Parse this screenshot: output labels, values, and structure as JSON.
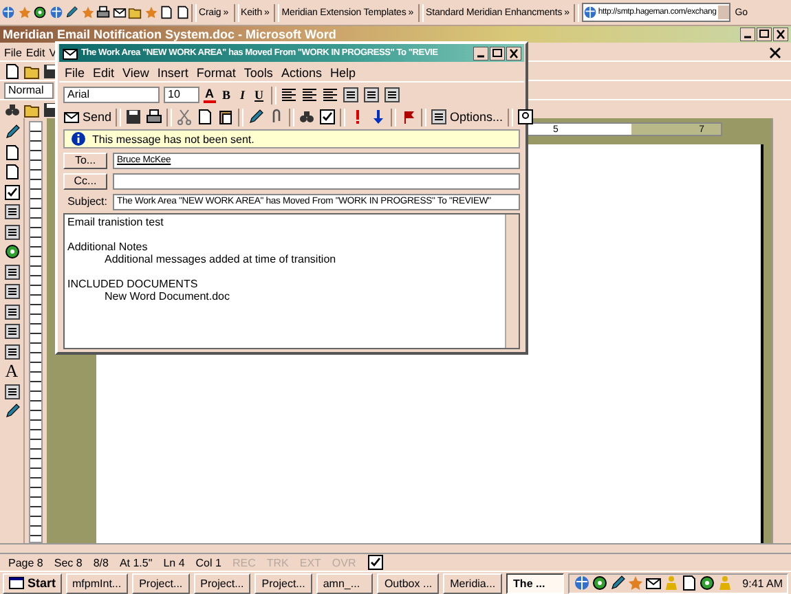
{
  "links_bar": {
    "links": [
      {
        "label": "Craig",
        "chevron": "»"
      },
      {
        "label": "Keith",
        "chevron": "»"
      },
      {
        "label": "Meridian Extension Templates",
        "chevron": "»"
      },
      {
        "label": "Standard Meridian Enhancments",
        "chevron": "»"
      }
    ],
    "address": "http://smtp.hageman.com/exchang",
    "go": "Go"
  },
  "word": {
    "title": "Meridian Email Notification System.doc - Microsoft Word",
    "menu": [
      "File",
      "Edit",
      "V"
    ],
    "style": "Normal",
    "drawing_letter": "A",
    "ruler_labels": [
      "5",
      "7"
    ]
  },
  "email": {
    "title": "The Work Area \"NEW WORK AREA\" has Moved From \"WORK IN PROGRESS\" To \"REVIE",
    "menu": [
      "File",
      "Edit",
      "View",
      "Insert",
      "Format",
      "Tools",
      "Actions",
      "Help"
    ],
    "font": "Arial",
    "size": "10",
    "font_color": "A",
    "format_buttons": [
      "B",
      "I",
      "U"
    ],
    "send": "Send",
    "options": "Options...",
    "notice": "This message has not been sent.",
    "to_button": "To...",
    "to": "Bruce McKee",
    "cc_button": "Cc...",
    "subject_label": "Subject:",
    "subject": "The Work Area \"NEW WORK AREA\" has Moved From \"WORK IN PROGRESS\" To \"REVIEW\"",
    "body": [
      {
        "text": "Email tranistion test"
      },
      {
        "text": "Additional Notes",
        "children": [
          {
            "text": "Additional messages added at time of transition"
          }
        ]
      },
      {
        "text": "INCLUDED DOCUMENTS",
        "children": [
          {
            "text": "New Word Document.doc"
          }
        ]
      }
    ]
  },
  "status_bar": {
    "fields": [
      "Page 8",
      "Sec 8",
      "8/8",
      "At 1.5\"",
      "Ln 4",
      "Col 1"
    ],
    "indicators": [
      {
        "label": "REC",
        "on": false
      },
      {
        "label": "TRK",
        "on": false
      },
      {
        "label": "EXT",
        "on": false
      },
      {
        "label": "OVR",
        "on": false
      }
    ]
  },
  "taskbar": {
    "start": "Start",
    "tasks": [
      {
        "label": "mfpmInt...",
        "selected": false
      },
      {
        "label": "Project...",
        "selected": false
      },
      {
        "label": "Project...",
        "selected": false
      },
      {
        "label": "Project...",
        "selected": false
      },
      {
        "label": "amn_...",
        "selected": false
      },
      {
        "label": "Outbox ...",
        "selected": false
      },
      {
        "label": "Meridia...",
        "selected": false
      },
      {
        "label": "The ...",
        "selected": true
      }
    ],
    "clock": "9:41 AM"
  }
}
